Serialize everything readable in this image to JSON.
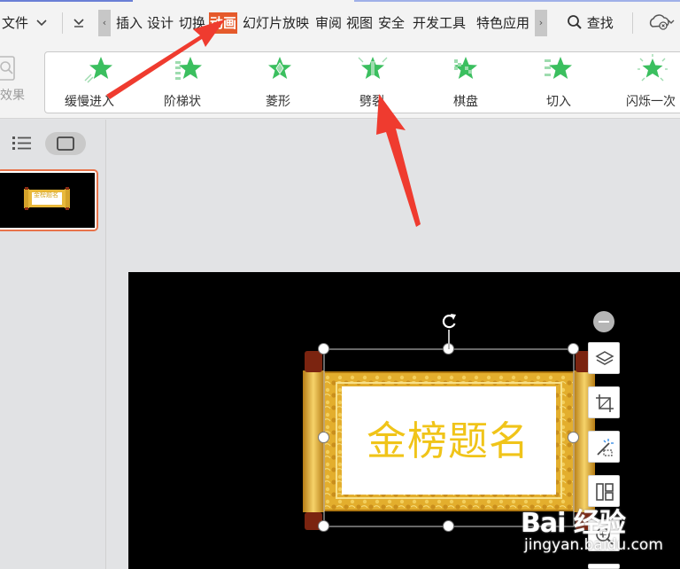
{
  "menubar": {
    "file_label": "文件",
    "tabs": [
      {
        "label": "插入",
        "active": false
      },
      {
        "label": "设计",
        "active": false
      },
      {
        "label": "切换",
        "active": false
      },
      {
        "label": "动画",
        "active": true
      },
      {
        "label": "幻灯片放映",
        "active": false
      },
      {
        "label": "审阅",
        "active": false
      },
      {
        "label": "视图",
        "active": false
      },
      {
        "label": "安全",
        "active": false
      },
      {
        "label": "开发工具",
        "active": false
      },
      {
        "label": "特色应用",
        "active": false
      }
    ],
    "search_label": "查找",
    "active_tab_color": "#e55a2b"
  },
  "ribbon": {
    "effect_pane_label": "效果",
    "animations": [
      {
        "label": "缓慢进入",
        "icon": "slow-enter-star-icon"
      },
      {
        "label": "阶梯状",
        "icon": "stairs-star-icon"
      },
      {
        "label": "菱形",
        "icon": "diamond-star-icon"
      },
      {
        "label": "劈裂",
        "icon": "split-star-icon"
      },
      {
        "label": "棋盘",
        "icon": "checkerboard-star-icon"
      },
      {
        "label": "切入",
        "icon": "cut-in-star-icon"
      },
      {
        "label": "闪烁一次",
        "icon": "flash-once-star-icon"
      }
    ],
    "icon_color": "#3bbf5f"
  },
  "slide": {
    "title_text": "金榜题名",
    "thumbnail_text": "金榜题名"
  },
  "floating_tools": [
    "layers-icon",
    "crop-icon",
    "magic-wand-icon",
    "layout-icon",
    "zoom-in-icon"
  ],
  "watermark": {
    "logo": "Bai 经验",
    "url": "jingyan.baidu.com"
  }
}
